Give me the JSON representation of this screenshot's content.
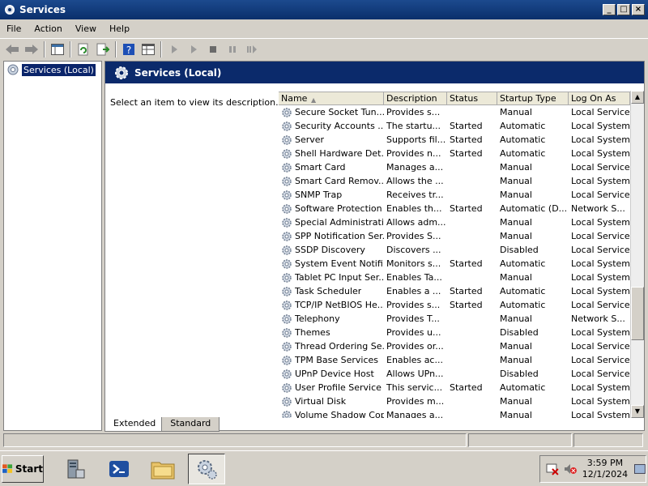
{
  "window": {
    "title": "Services"
  },
  "menu": [
    "File",
    "Action",
    "View",
    "Help"
  ],
  "tree": {
    "selected_label": "Services (Local)"
  },
  "banner": {
    "title": "Services (Local)"
  },
  "description_prompt": "Select an item to view its description.",
  "columns": [
    "Name",
    "Description",
    "Status",
    "Startup Type",
    "Log On As"
  ],
  "services": [
    {
      "name": "Secure Socket Tun...",
      "desc": "Provides s...",
      "status": "",
      "startup": "Manual",
      "logon": "Local Service"
    },
    {
      "name": "Security Accounts ...",
      "desc": "The startu...",
      "status": "Started",
      "startup": "Automatic",
      "logon": "Local System"
    },
    {
      "name": "Server",
      "desc": "Supports fil...",
      "status": "Started",
      "startup": "Automatic",
      "logon": "Local System"
    },
    {
      "name": "Shell Hardware Det...",
      "desc": "Provides n...",
      "status": "Started",
      "startup": "Automatic",
      "logon": "Local System"
    },
    {
      "name": "Smart Card",
      "desc": "Manages a...",
      "status": "",
      "startup": "Manual",
      "logon": "Local Service"
    },
    {
      "name": "Smart Card Remov...",
      "desc": "Allows the ...",
      "status": "",
      "startup": "Manual",
      "logon": "Local System"
    },
    {
      "name": "SNMP Trap",
      "desc": "Receives tr...",
      "status": "",
      "startup": "Manual",
      "logon": "Local Service"
    },
    {
      "name": "Software Protection",
      "desc": "Enables th...",
      "status": "Started",
      "startup": "Automatic (D...",
      "logon": "Network S..."
    },
    {
      "name": "Special Administrati...",
      "desc": "Allows adm...",
      "status": "",
      "startup": "Manual",
      "logon": "Local System"
    },
    {
      "name": "SPP Notification Ser...",
      "desc": "Provides S...",
      "status": "",
      "startup": "Manual",
      "logon": "Local Service"
    },
    {
      "name": "SSDP Discovery",
      "desc": "Discovers ...",
      "status": "",
      "startup": "Disabled",
      "logon": "Local Service"
    },
    {
      "name": "System Event Notifi...",
      "desc": "Monitors s...",
      "status": "Started",
      "startup": "Automatic",
      "logon": "Local System"
    },
    {
      "name": "Tablet PC Input Ser...",
      "desc": "Enables Ta...",
      "status": "",
      "startup": "Manual",
      "logon": "Local System"
    },
    {
      "name": "Task Scheduler",
      "desc": "Enables a ...",
      "status": "Started",
      "startup": "Automatic",
      "logon": "Local System"
    },
    {
      "name": "TCP/IP NetBIOS He...",
      "desc": "Provides s...",
      "status": "Started",
      "startup": "Automatic",
      "logon": "Local Service"
    },
    {
      "name": "Telephony",
      "desc": "Provides T...",
      "status": "",
      "startup": "Manual",
      "logon": "Network S..."
    },
    {
      "name": "Themes",
      "desc": "Provides u...",
      "status": "",
      "startup": "Disabled",
      "logon": "Local System"
    },
    {
      "name": "Thread Ordering Se...",
      "desc": "Provides or...",
      "status": "",
      "startup": "Manual",
      "logon": "Local Service"
    },
    {
      "name": "TPM Base Services",
      "desc": "Enables ac...",
      "status": "",
      "startup": "Manual",
      "logon": "Local Service"
    },
    {
      "name": "UPnP Device Host",
      "desc": "Allows UPn...",
      "status": "",
      "startup": "Disabled",
      "logon": "Local Service"
    },
    {
      "name": "User Profile Service",
      "desc": "This servic...",
      "status": "Started",
      "startup": "Automatic",
      "logon": "Local System"
    },
    {
      "name": "Virtual Disk",
      "desc": "Provides m...",
      "status": "",
      "startup": "Manual",
      "logon": "Local System"
    },
    {
      "name": "Volume Shadow Copy",
      "desc": "Manages a...",
      "status": "",
      "startup": "Manual",
      "logon": "Local System"
    }
  ],
  "tabs": [
    "Extended",
    "Standard"
  ],
  "taskbar": {
    "start_label": "Start",
    "time": "3:59 PM",
    "date": "12/1/2024"
  },
  "colors": {
    "title_bar": "#0a2f6b",
    "banner": "#0b2a6b",
    "selection": "#0a246a",
    "chrome": "#d4d0c8"
  }
}
